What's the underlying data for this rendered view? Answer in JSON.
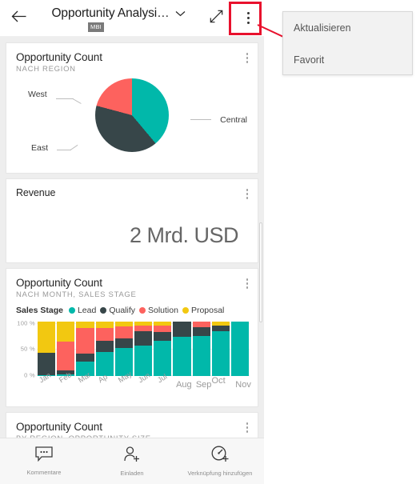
{
  "header": {
    "back_icon": "back-arrow-icon",
    "title": "Opportunity Analysi…",
    "badge": "MBI",
    "chevron_icon": "chevron-down-icon",
    "expand_icon": "expand-fullscreen-icon",
    "more_icon": "more-vertical-icon"
  },
  "menu": {
    "items": [
      {
        "label": "Aktualisieren"
      },
      {
        "label": "Favorit"
      }
    ]
  },
  "cards": [
    {
      "title": "Opportunity Count",
      "subtitle": "NACH REGION",
      "more_icon": "more-vertical-icon"
    },
    {
      "title": "Revenue",
      "value": "2 Mrd. USD",
      "more_icon": "more-vertical-icon"
    },
    {
      "title": "Opportunity Count",
      "subtitle": "NACH MONTH, SALES STAGE",
      "more_icon": "more-vertical-icon"
    },
    {
      "title": "Opportunity Count",
      "subtitle": "BY REGION, OPPORTUNITY SIZE",
      "more_icon": "more-vertical-icon"
    }
  ],
  "legend": {
    "title": "Sales Stage",
    "items": [
      {
        "label": "Lead",
        "color": "#01b8aa"
      },
      {
        "label": "Qualify",
        "color": "#374649"
      },
      {
        "label": "Solution",
        "color": "#fd625e"
      },
      {
        "label": "Proposal",
        "color": "#f2c811"
      }
    ]
  },
  "bottom_nav": {
    "items": [
      {
        "label": "Kommentare",
        "icon": "comment-icon"
      },
      {
        "label": "Einladen",
        "icon": "person-add-icon"
      },
      {
        "label": "Verknüpfung hinzufügen",
        "icon": "gauge-add-icon"
      }
    ]
  },
  "colors": {
    "teal": "#01b8aa",
    "dark": "#374649",
    "red": "#fd625e",
    "yellow": "#f2c811",
    "highlight": "#e8112d"
  },
  "chart_data": [
    {
      "type": "pie",
      "title": "Opportunity Count",
      "subtitle": "NACH REGION",
      "labels": [
        "Central",
        "East",
        "West"
      ],
      "values": [
        39,
        40,
        21
      ],
      "colors": [
        "#01b8aa",
        "#374649",
        "#fd625e"
      ],
      "legend": "callout-labels"
    },
    {
      "type": "bar",
      "title": "Opportunity Count",
      "subtitle": "NACH MONTH, SALES STAGE",
      "stacked": true,
      "normalized": true,
      "ylabel": "",
      "xlabel": "",
      "ylim": [
        0,
        100
      ],
      "yticks": [
        "0 %",
        "50 %",
        "100 %"
      ],
      "grid": true,
      "categories": [
        "Jan",
        "Feb",
        "Mar",
        "Ap",
        "May",
        "Jun",
        "Jul",
        "Aug",
        "Sep",
        "Oct",
        "Nov"
      ],
      "series": [
        {
          "name": "Lead",
          "color": "#01b8aa",
          "values": [
            2,
            3,
            26,
            44,
            52,
            56,
            64,
            72,
            74,
            83,
            100
          ]
        },
        {
          "name": "Qualify",
          "color": "#374649",
          "values": [
            40,
            8,
            15,
            21,
            17,
            26,
            17,
            28,
            16,
            9,
            0
          ]
        },
        {
          "name": "Solution",
          "color": "#fd625e",
          "values": [
            0,
            53,
            47,
            24,
            22,
            10,
            12,
            0,
            10,
            0,
            0
          ]
        },
        {
          "name": "Proposal",
          "color": "#f2c811",
          "values": [
            58,
            36,
            12,
            11,
            9,
            8,
            7,
            0,
            0,
            8,
            0
          ]
        }
      ]
    }
  ]
}
